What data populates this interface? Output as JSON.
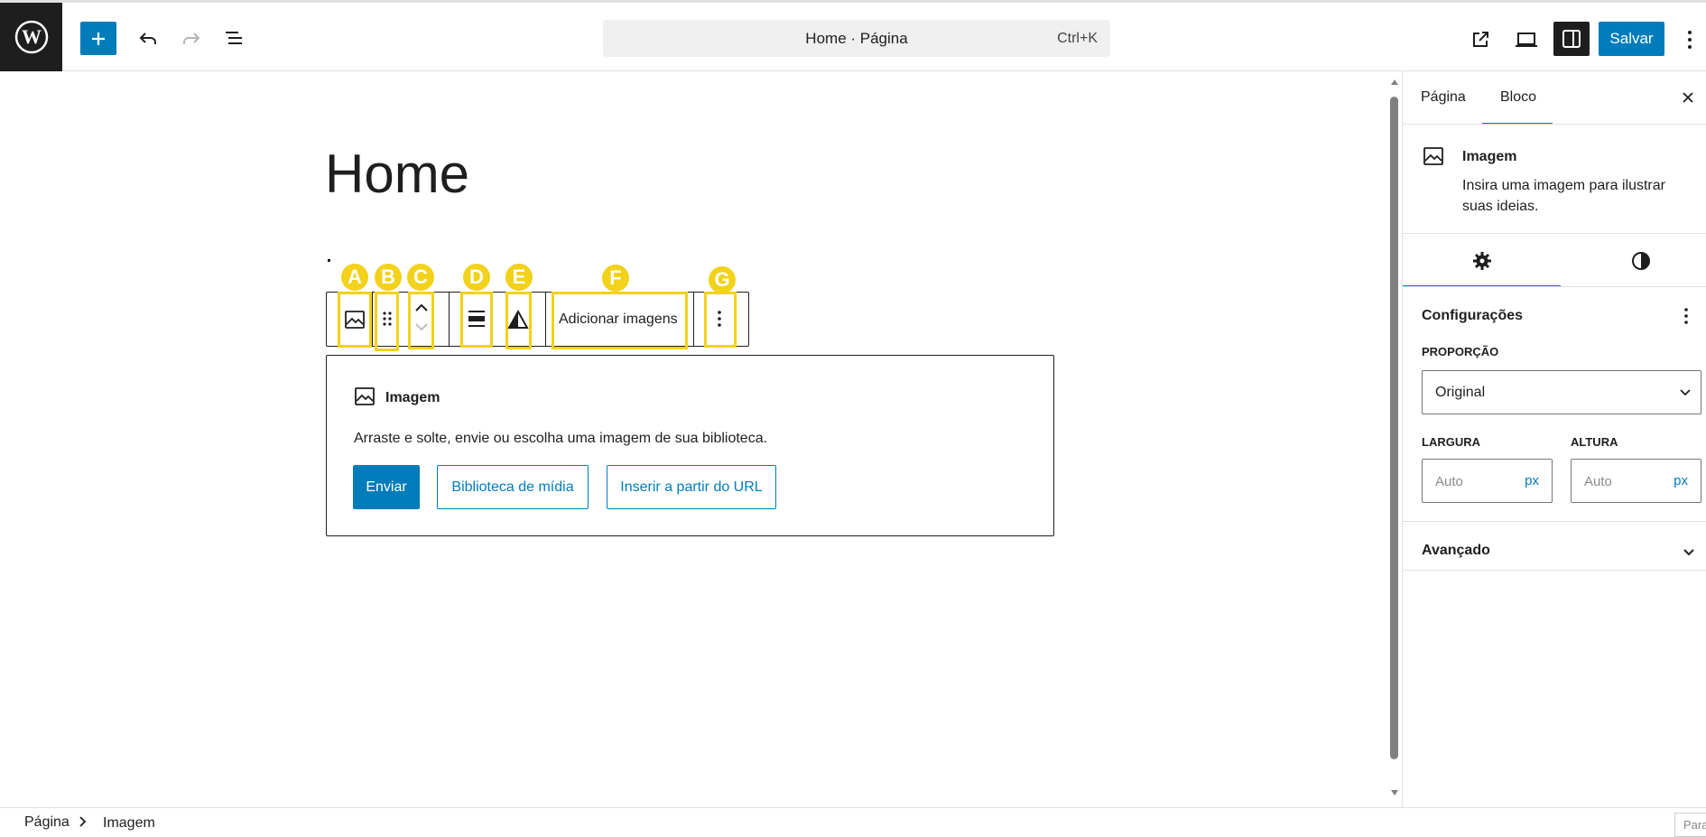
{
  "header": {
    "doc_title": "Home · Página",
    "shortcut": "Ctrl+K",
    "save_label": "Salvar"
  },
  "canvas": {
    "page_title": "Home"
  },
  "block_toolbar": {
    "add_images_label": "Adicionar imagens",
    "markers": [
      "A",
      "B",
      "C",
      "D",
      "E",
      "F",
      "G"
    ]
  },
  "placeholder": {
    "title": "Imagem",
    "description": "Arraste e solte, envie ou escolha uma imagem de sua biblioteca.",
    "buttons": {
      "upload": "Enviar",
      "library": "Biblioteca de mídia",
      "url": "Inserir a partir do URL"
    }
  },
  "sidebar": {
    "tabs": [
      "Página",
      "Bloco"
    ],
    "active_tab": "Bloco",
    "block": {
      "name": "Imagem",
      "description": "Insira uma imagem para ilustrar suas ideias."
    },
    "settings": {
      "title": "Configurações",
      "ratio_label": "PROPORÇÃO",
      "ratio_value": "Original",
      "width_label": "LARGURA",
      "height_label": "ALTURA",
      "width_placeholder": "Auto",
      "height_placeholder": "Auto",
      "unit": "px"
    },
    "advanced_title": "Avançado"
  },
  "footer": {
    "breadcrumbs": [
      "Página",
      "Imagem"
    ],
    "stub_text": "Parar"
  },
  "colors": {
    "accent": "#007cba",
    "marker": "#f2d21a",
    "dark": "#1e1e1e"
  }
}
